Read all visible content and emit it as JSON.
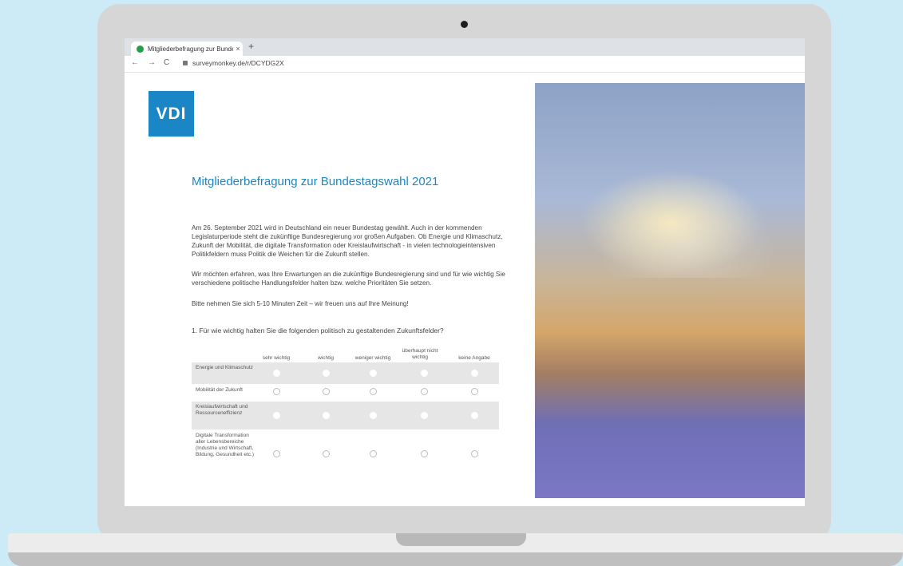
{
  "browser": {
    "tab_title": "Mitgliederbefragung zur Bundest",
    "tab_close": "×",
    "new_tab": "+",
    "url": "surveymonkey.de/r/DCYDG2X",
    "back": "←",
    "forward": "→",
    "reload": "C"
  },
  "page": {
    "logo": "VDI",
    "title": "Mitgliederbefragung zur Bundestagswahl 2021",
    "paragraphs": [
      "Am 26. September 2021 wird in Deutschland ein neuer Bundestag gewählt. Auch in der kommenden Legislaturperiode steht die zukünftige Bundesregierung vor großen Aufgaben. Ob Energie und Klimaschutz, Zukunft der Mobilität, die digitale Transformation oder Kreislaufwirtschaft - in vielen technologieintensiven Politikfeldern muss Politik die Weichen für die Zukunft stellen.",
      "Wir möchten erfahren, was Ihre Erwartungen an die zukünftige Bundesregierung sind und für wie wichtig Sie verschiedene politische Handlungsfelder halten bzw. welche Prioritäten Sie setzen.",
      "Bitte nehmen Sie sich 5-10 Minuten Zeit – wir freuen uns auf Ihre Meinung!"
    ],
    "question": "1. Für wie wichtig halten Sie die folgenden politisch zu gestaltenden Zukunftsfelder?",
    "columns": [
      "sehr wichtig",
      "wichtig",
      "weniger wichtig",
      "überhaupt nicht wichtig",
      "keine Angabe"
    ],
    "rows": [
      "Energie und Klimaschutz",
      "Mobilität der Zukunft",
      "Kreislaufwirtschaft und Ressourceneffizienz",
      "Digitale Transformation aller Lebensbereiche (Industrie und Wirtschaft, Bildung, Gesundheit etc.)"
    ]
  }
}
